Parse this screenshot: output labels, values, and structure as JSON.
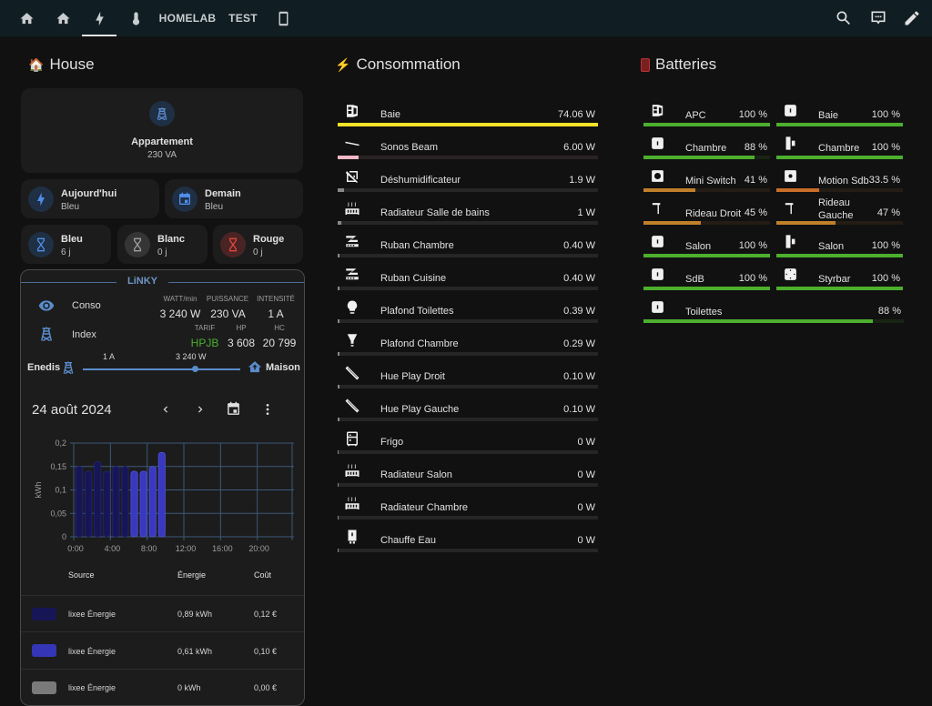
{
  "topbar": {
    "tabs": [
      {
        "icon": "home-icon"
      },
      {
        "icon": "home-icon"
      },
      {
        "icon": "lightning-icon",
        "active": true
      },
      {
        "icon": "thermometer-icon"
      },
      {
        "label": "HOMELAB"
      },
      {
        "label": "TEST"
      },
      {
        "icon": "tablet-icon"
      }
    ],
    "actions": [
      "search-icon",
      "assist-icon",
      "edit-pencil-icon"
    ]
  },
  "house": {
    "title": "House",
    "emoji": "🏠",
    "appartement": {
      "name": "Appartement",
      "state": "230 VA"
    },
    "tiles": [
      {
        "name": "Aujourd'hui",
        "state": "Bleu",
        "color": "#4f8de8",
        "bg": "#1f2f44"
      },
      {
        "name": "Demain",
        "state": "Bleu",
        "color": "#4f8de8",
        "bg": "#1f2f44"
      },
      {
        "name": "Bleu",
        "state": "6 j",
        "color": "#4f8de8",
        "bg": "#1f2f44"
      },
      {
        "name": "Blanc",
        "state": "0 j",
        "color": "#9e9e9e",
        "bg": "#353535"
      },
      {
        "name": "Rouge",
        "state": "0 j",
        "color": "#e0453b",
        "bg": "#4a2424"
      }
    ]
  },
  "linky": {
    "title": "LiNKY",
    "conso_label": "Conso",
    "index_label": "Index",
    "heads1": [
      "WATT/min",
      "PUISSANCE",
      "INTENSITÉ"
    ],
    "vals1": [
      "3 240 W",
      "230 VA",
      "1 A"
    ],
    "heads2": [
      "TARIF",
      "HP",
      "HC"
    ],
    "vals2": [
      "HPJB",
      "3 608",
      "20 799"
    ],
    "tarif_color": "#4caf2e",
    "flow": {
      "left": "Enedis",
      "right": "Maison",
      "current": "1 A",
      "power": "3 240 W"
    },
    "date": "24 août 2024",
    "table": {
      "headers": [
        "Source",
        "Énergie",
        "Coût"
      ],
      "rows": [
        {
          "source": "lixee Énergie",
          "energy": "0,89 kWh",
          "cost": "0,12 €",
          "color": "#161657"
        },
        {
          "source": "lixee Énergie",
          "energy": "0,61 kWh",
          "cost": "0,10 €",
          "color": "#3535b8"
        },
        {
          "source": "lixee Énergie",
          "energy": "0 kWh",
          "cost": "0,00 €",
          "color": "#7a7a7a"
        }
      ]
    }
  },
  "chart_data": {
    "type": "bar",
    "ylabel": "kWh",
    "ylim": [
      0,
      0.2
    ],
    "yticks": [
      "0",
      "0,05",
      "0,1",
      "0,15",
      "0,2"
    ],
    "xticks": [
      "0:00",
      "4:00",
      "8:00",
      "12:00",
      "16:00",
      "20:00"
    ],
    "x_range_hours": [
      0,
      24
    ],
    "grid": true,
    "series": [
      {
        "name": "lixee Énergie (HC)",
        "color": "#161657",
        "hours": [
          0,
          1,
          2,
          3,
          4,
          5
        ],
        "values": [
          0.15,
          0.14,
          0.16,
          0.14,
          0.15,
          0.15
        ]
      },
      {
        "name": "lixee Énergie (HP)",
        "color": "#3838c0",
        "hours": [
          6,
          7,
          8,
          9
        ],
        "values": [
          0.14,
          0.14,
          0.15,
          0.18
        ]
      }
    ]
  },
  "consommation": {
    "title": "Consommation",
    "emoji": "⚡",
    "max": 74.06,
    "items": [
      {
        "name": "Baie",
        "value": "74.06 W",
        "num": 74.06,
        "icon": "server-icon",
        "color": "#f5e327",
        "track": "#2b2a12"
      },
      {
        "name": "Sonos Beam",
        "value": "6.00 W",
        "num": 6.0,
        "icon": "soundbar-icon",
        "color": "#f2b8c6",
        "track": "#2a2224"
      },
      {
        "name": "Déshumidificateur",
        "value": "1.9 W",
        "num": 1.9,
        "icon": "dehumidifier-icon",
        "color": "#888888",
        "track": "#262626"
      },
      {
        "name": "Radiateur Salle de bains",
        "value": "1 W",
        "num": 1,
        "icon": "radiator-icon",
        "color": "#888888",
        "track": "#262626"
      },
      {
        "name": "Ruban Chambre",
        "value": "0.40 W",
        "num": 0.4,
        "icon": "led-strip-icon",
        "color": "#888888",
        "track": "#262626"
      },
      {
        "name": "Ruban Cuisine",
        "value": "0.40 W",
        "num": 0.4,
        "icon": "led-strip-icon",
        "color": "#888888",
        "track": "#262626"
      },
      {
        "name": "Plafond Toilettes",
        "value": "0.39 W",
        "num": 0.39,
        "icon": "lightbulb-icon",
        "color": "#888888",
        "track": "#262626"
      },
      {
        "name": "Plafond Chambre",
        "value": "0.29 W",
        "num": 0.29,
        "icon": "spotlight-bulb-icon",
        "color": "#888888",
        "track": "#262626"
      },
      {
        "name": "Hue Play Droit",
        "value": "0.10 W",
        "num": 0.1,
        "icon": "light-bar-icon",
        "color": "#888888",
        "track": "#262626"
      },
      {
        "name": "Hue Play Gauche",
        "value": "0.10 W",
        "num": 0.1,
        "icon": "light-bar-icon",
        "color": "#888888",
        "track": "#262626"
      },
      {
        "name": "Frigo",
        "value": "0 W",
        "num": 0,
        "icon": "fridge-icon",
        "color": "#888888",
        "track": "#262626"
      },
      {
        "name": "Radiateur Salon",
        "value": "0 W",
        "num": 0,
        "icon": "radiator-icon",
        "color": "#888888",
        "track": "#262626"
      },
      {
        "name": "Radiateur Chambre",
        "value": "0 W",
        "num": 0,
        "icon": "radiator-icon",
        "color": "#888888",
        "track": "#262626"
      },
      {
        "name": "Chauffe Eau",
        "value": "0 W",
        "num": 0,
        "icon": "water-heater-icon",
        "color": "#888888",
        "track": "#262626"
      }
    ]
  },
  "batteries": {
    "title": "Batteries",
    "emoji": "🪫",
    "items": [
      {
        "name": "APC",
        "value": "100 %",
        "pct": 100,
        "icon": "ups-icon"
      },
      {
        "name": "Baie",
        "value": "100 %",
        "pct": 100,
        "icon": "sensor-icon"
      },
      {
        "name": "Chambre",
        "value": "88 %",
        "pct": 88,
        "icon": "sensor-icon"
      },
      {
        "name": "Chambre",
        "value": "100 %",
        "pct": 100,
        "icon": "door-sensor-icon"
      },
      {
        "name": "Mini Switch",
        "value": "41 %",
        "pct": 41,
        "icon": "button-icon"
      },
      {
        "name": "Motion Sdb",
        "value": "33.5 %",
        "pct": 33.5,
        "icon": "motion-sensor-icon"
      },
      {
        "name": "Rideau Droit",
        "value": "45 %",
        "pct": 45,
        "icon": "curtain-icon"
      },
      {
        "name": "Rideau Gauche",
        "value": "47 %",
        "pct": 47,
        "icon": "curtain-icon"
      },
      {
        "name": "Salon",
        "value": "100 %",
        "pct": 100,
        "icon": "sensor-icon"
      },
      {
        "name": "Salon",
        "value": "100 %",
        "pct": 100,
        "icon": "door-sensor-icon"
      },
      {
        "name": "SdB",
        "value": "100 %",
        "pct": 100,
        "icon": "sensor-icon"
      },
      {
        "name": "Styrbar",
        "value": "100 %",
        "pct": 100,
        "icon": "remote-icon"
      },
      {
        "name": "Toilettes",
        "value": "88 %",
        "pct": 88,
        "icon": "sensor-icon"
      }
    ],
    "colors": {
      "high": "#4caf2e",
      "mid": "#c0802a",
      "low_mid": "#c96d28"
    }
  }
}
